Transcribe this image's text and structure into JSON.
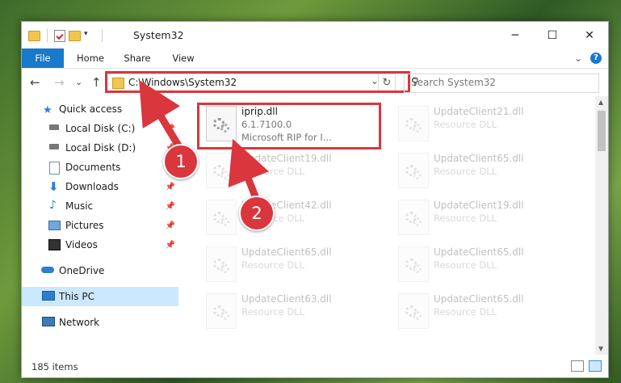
{
  "window": {
    "title": "System32"
  },
  "window_buttons": {
    "minimize": "─",
    "maximize": "☐",
    "close": "✕"
  },
  "ribbon": {
    "tabs": [
      "File",
      "Home",
      "Share",
      "View"
    ],
    "expand": "⌄",
    "help": "?"
  },
  "nav": {
    "back": "←",
    "forward": "→",
    "recent": "⌄",
    "up": "↑"
  },
  "address": {
    "path": "C:\\Windows\\System32",
    "dropdown": "⌄",
    "refresh": "↻"
  },
  "search": {
    "placeholder": "Search System32",
    "icon": "⚲"
  },
  "sidebar": {
    "items": [
      {
        "label": "Quick access",
        "icon": "star-icon",
        "pinned": false
      },
      {
        "label": "Local Disk (C:)",
        "icon": "drive-icon",
        "pinned": true
      },
      {
        "label": "Local Disk (D:)",
        "icon": "drive-icon",
        "pinned": true
      },
      {
        "label": "Documents",
        "icon": "documents-icon",
        "pinned": true
      },
      {
        "label": "Downloads",
        "icon": "downloads-icon",
        "pinned": true
      },
      {
        "label": "Music",
        "icon": "music-icon",
        "pinned": true
      },
      {
        "label": "Pictures",
        "icon": "pictures-icon",
        "pinned": true
      },
      {
        "label": "Videos",
        "icon": "videos-icon",
        "pinned": true
      },
      {
        "label": "OneDrive",
        "icon": "cloud-icon",
        "pinned": false
      },
      {
        "label": "This PC",
        "icon": "pc-icon",
        "pinned": false,
        "selected": true
      },
      {
        "label": "Network",
        "icon": "network-icon",
        "pinned": false
      }
    ],
    "pin_glyph": "📌"
  },
  "files": [
    {
      "name": "iprip.dll",
      "line1": "6.1.7100.0",
      "line2": "Microsoft RIP for I...",
      "highlighted": true
    },
    {
      "name": "UpdateClient21.dll",
      "line1": "Resource DLL",
      "line2": ""
    },
    {
      "name": "UpdateClient19.dll",
      "line1": "Resource DLL",
      "line2": ""
    },
    {
      "name": "UpdateClient65.dll",
      "line1": "Resource DLL",
      "line2": ""
    },
    {
      "name": "UpdateClient42.dll",
      "line1": "Resource DLL",
      "line2": ""
    },
    {
      "name": "UpdateClient19.dll",
      "line1": "Resource DLL",
      "line2": ""
    },
    {
      "name": "UpdateClient65.dll",
      "line1": "Resource DLL",
      "line2": ""
    },
    {
      "name": "UpdateClient65.dll",
      "line1": "Resource DLL",
      "line2": ""
    },
    {
      "name": "UpdateClient63.dll",
      "line1": "Resource DLL",
      "line2": ""
    },
    {
      "name": "UpdateClient65.dll",
      "line1": "Resource DLL",
      "line2": ""
    }
  ],
  "status": {
    "item_count": "185 items"
  },
  "annotations": {
    "step1": "1",
    "step2": "2",
    "color": "#d9363e"
  }
}
